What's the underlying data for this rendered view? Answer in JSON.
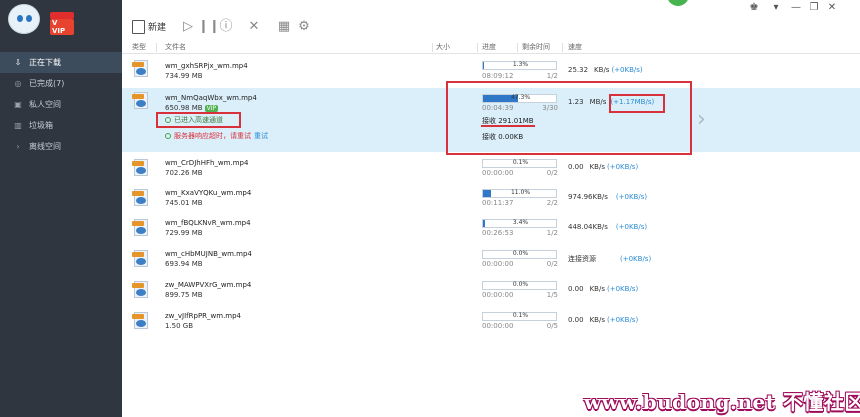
{
  "brand": {
    "vip_label": "V VIP"
  },
  "sidebar": {
    "items": [
      {
        "label": "正在下载",
        "icon": "download-icon",
        "active": true
      },
      {
        "label": "已完成(7)",
        "icon": "check-circle-icon",
        "active": false
      },
      {
        "label": "私人空间",
        "icon": "private-space-icon",
        "active": false
      },
      {
        "label": "垃圾箱",
        "icon": "trash-icon",
        "active": false
      },
      {
        "label": "离线空间",
        "icon": "cloud-icon",
        "active": false
      }
    ]
  },
  "toolbar": {
    "new_label": "新建",
    "buttons": [
      "play-icon",
      "pause-icon",
      "delete-warning-icon",
      "close-icon",
      "grid-view-icon",
      "gear-icon"
    ]
  },
  "columns": {
    "type": "类型",
    "filename": "文件名",
    "size": "大小",
    "progress": "进度",
    "remaining": "剩余时间",
    "speed": "速度"
  },
  "rows": [
    {
      "name": "wm_gxhSRPjx_wm.mp4",
      "size": "734.99 MB",
      "progress": 0.013,
      "progress_text": "1.3%",
      "remaining": "08:09:12",
      "parts": "1/2",
      "speed": "25.32",
      "speed_unit": "KB/s",
      "speed_extra": "(+0KB/s)"
    },
    {
      "name": "wm_NmQaqWbx_wm.mp4",
      "size": "650.98 MB",
      "vip_tag": "VIP",
      "progress": 0.473,
      "progress_text": "47.3%",
      "remaining": "00:04:39",
      "parts": "3/30",
      "speed": "1.23",
      "speed_unit": "MB/s",
      "speed_extra": "(+1.17MB/s)",
      "highspeed_text": "已进入高速通道",
      "error_text": "服务器响应超时，请重试",
      "retry_label": "重试",
      "recv_1": "接收 291.01MB",
      "recv_2": "接收 0.00KB"
    },
    {
      "name": "wm_CrDJhHFh_wm.mp4",
      "size": "702.26 MB",
      "progress": 0.001,
      "progress_text": "0.1%",
      "remaining": "00:00:00",
      "parts": "0/2",
      "speed": "0.00",
      "speed_unit": "KB/s",
      "speed_extra": "(+0KB/s)"
    },
    {
      "name": "wm_KxaVYQKu_wm.mp4",
      "size": "745.01 MB",
      "progress": 0.11,
      "progress_text": "11.0%",
      "remaining": "00:11:37",
      "parts": "2/2",
      "speed": "974.96KB/s",
      "speed_unit": "",
      "speed_extra": "(+0KB/s)"
    },
    {
      "name": "wm_fBQLKNvR_wm.mp4",
      "size": "729.99 MB",
      "progress": 0.034,
      "progress_text": "3.4%",
      "remaining": "00:26:53",
      "parts": "1/2",
      "speed": "448.04KB/s",
      "speed_unit": "",
      "speed_extra": "(+0KB/s)"
    },
    {
      "name": "wm_cHbMUJNB_wm.mp4",
      "size": "693.94 MB",
      "progress": 0.0,
      "progress_text": "0.0%",
      "remaining": "00:00:00",
      "parts": "0/2",
      "speed": "连接资源",
      "speed_unit": "",
      "speed_extra": "(+0KB/s)"
    },
    {
      "name": "zw_MAWPVXrG_wm.mp4",
      "size": "899.75 MB",
      "progress": 0.0,
      "progress_text": "0.0%",
      "remaining": "00:00:00",
      "parts": "1/5",
      "speed": "0.00",
      "speed_unit": "KB/s",
      "speed_extra": "(+0KB/s)"
    },
    {
      "name": "zw_vJIfRpPR_wm.mp4",
      "size": "1.50 GB",
      "progress": 0.001,
      "progress_text": "0.1%",
      "remaining": "00:00:00",
      "parts": "0/5",
      "speed": "0.00",
      "speed_unit": "KB/s",
      "speed_extra": "(+0KB/s)"
    }
  ],
  "watermark": "www.budong.net 不懂社区",
  "colors": {
    "sidebar_bg": "#2f3640",
    "selected_row": "#dbeffa",
    "progress_fill": "#2f78c8",
    "accent_blue": "#2a8bd6",
    "annotation_red": "#d9313c"
  }
}
